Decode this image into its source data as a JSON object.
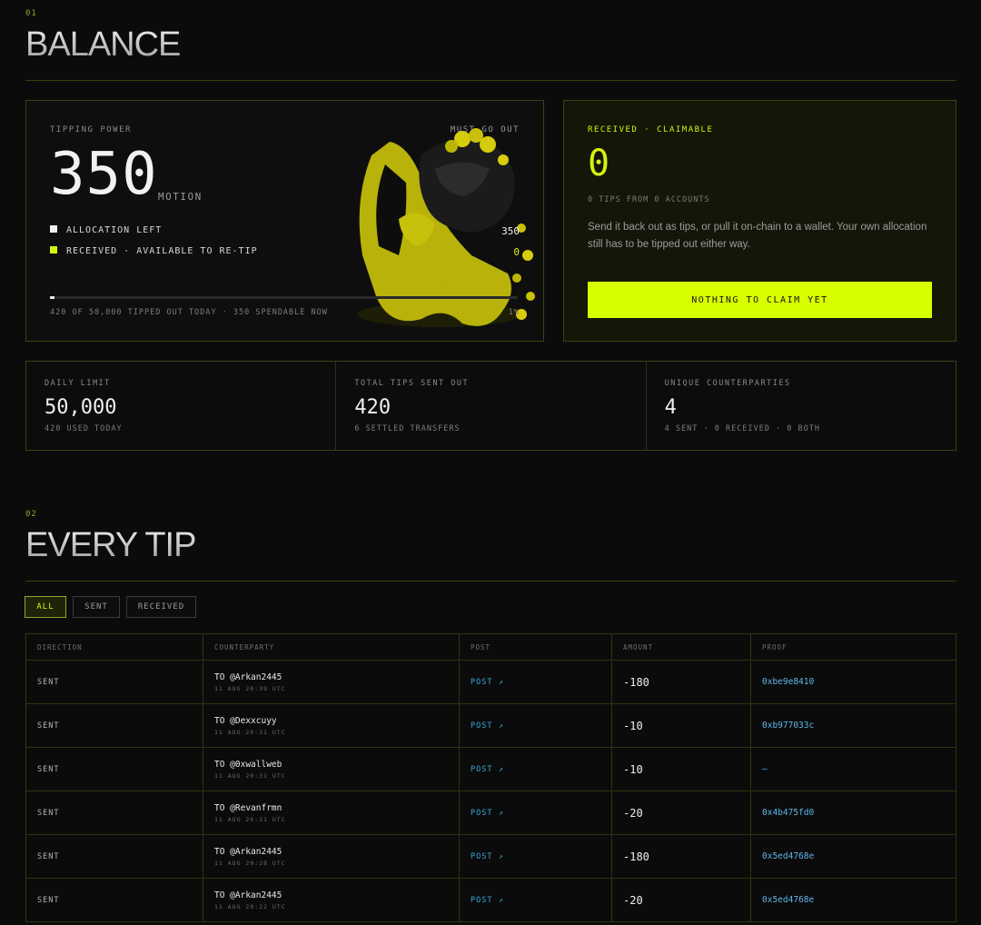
{
  "balance": {
    "section_num": "01",
    "title": "BALANCE",
    "power": {
      "label": "TIPPING POWER",
      "tag": "MUST GO OUT",
      "value": "350",
      "unit": "MOTION",
      "legend": [
        {
          "label": "ALLOCATION LEFT",
          "value": "350",
          "color": "#f0f0f0"
        },
        {
          "label": "RECEIVED · AVAILABLE TO RE-TIP",
          "value": "0",
          "color": "#d7f20b"
        }
      ],
      "progress_fraction": 0.01,
      "footnote": "420 OF 50,000 TIPPED OUT TODAY · 350 SPENDABLE NOW",
      "percent": "1%"
    },
    "received": {
      "label": "RECEIVED · CLAIMABLE",
      "value": "0",
      "sub": "0 TIPS FROM 0 ACCOUNTS",
      "description": "Send it back out as tips, or pull it on-chain to a wallet. Your own allocation still has to be tipped out either way.",
      "button": "NOTHING TO CLAIM YET"
    },
    "stats": [
      {
        "label": "DAILY LIMIT",
        "value": "50,000",
        "sub": "420 USED TODAY"
      },
      {
        "label": "TOTAL TIPS SENT OUT",
        "value": "420",
        "sub": "6 SETTLED TRANSFERS"
      },
      {
        "label": "UNIQUE COUNTERPARTIES",
        "value": "4",
        "sub": "4 SENT · 0 RECEIVED · 0 BOTH"
      }
    ]
  },
  "tips": {
    "section_num": "02",
    "title": "EVERY TIP",
    "filters": [
      "ALL",
      "SENT",
      "RECEIVED"
    ],
    "active_filter": "ALL",
    "columns": [
      "DIRECTION",
      "COUNTERPARTY",
      "POST",
      "AMOUNT",
      "PROOF"
    ],
    "rows": [
      {
        "direction": "SENT",
        "counterparty": "TO @Arkan2445",
        "time": "11 AUG 20:39 UTC",
        "post": "POST ↗",
        "amount": "-180",
        "proof": "0xbe9e8410"
      },
      {
        "direction": "SENT",
        "counterparty": "TO @Dexxcuyy",
        "time": "11 AUG 20:31 UTC",
        "post": "POST ↗",
        "amount": "-10",
        "proof": "0xb977033c"
      },
      {
        "direction": "SENT",
        "counterparty": "TO @0xwallweb",
        "time": "11 AUG 20:31 UTC",
        "post": "POST ↗",
        "amount": "-10",
        "proof": "—"
      },
      {
        "direction": "SENT",
        "counterparty": "TO @Revanfrmn",
        "time": "11 AUG 20:31 UTC",
        "post": "POST ↗",
        "amount": "-20",
        "proof": "0x4b475fd0"
      },
      {
        "direction": "SENT",
        "counterparty": "TO @Arkan2445",
        "time": "11 AUG 20:28 UTC",
        "post": "POST ↗",
        "amount": "-180",
        "proof": "0x5ed4768e"
      },
      {
        "direction": "SENT",
        "counterparty": "TO @Arkan2445",
        "time": "11 AUG 20:22 UTC",
        "post": "POST ↗",
        "amount": "-20",
        "proof": "0x5ed4768e"
      }
    ]
  },
  "icons": {
    "mascot": "coin-sack-mascot-illustration",
    "external": "arrow-up-right-icon"
  }
}
